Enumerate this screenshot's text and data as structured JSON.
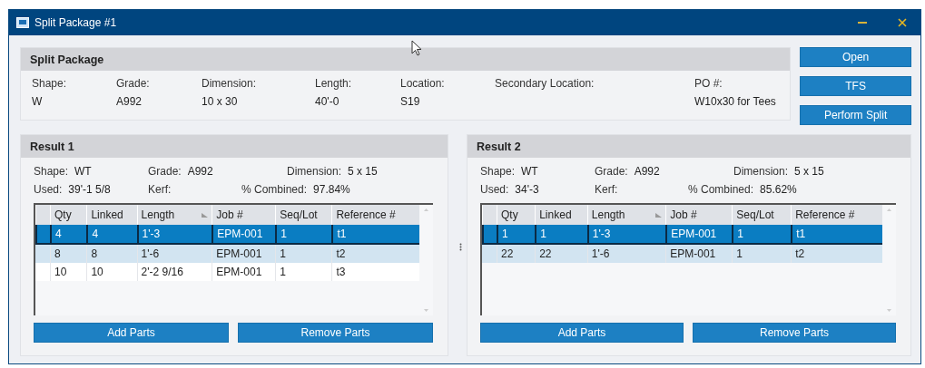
{
  "window": {
    "title": "Split Package #1"
  },
  "package": {
    "title": "Split Package",
    "fields": [
      {
        "label": "Shape:",
        "value": "W"
      },
      {
        "label": "Grade:",
        "value": "A992"
      },
      {
        "label": "Dimension:",
        "value": "10 x 30"
      },
      {
        "label": "Length:",
        "value": "40'-0"
      },
      {
        "label": "Location:",
        "value": "S19"
      },
      {
        "label": "Secondary Location:"
      },
      {
        "label": "PO #:",
        "value": "W10x30 for Tees"
      }
    ]
  },
  "buttons": [
    "Open",
    "TFS",
    "Perform Split"
  ],
  "results": [
    {
      "title": "Result 1",
      "info": [
        [
          {
            "label": "Shape:",
            "value": "WT"
          },
          {
            "label": "Grade:",
            "value": "A992"
          },
          {
            "label": "Dimension:",
            "value": "5 x 15"
          }
        ],
        [
          {
            "label": "Used:",
            "value": "39'-1 5/8"
          },
          {
            "label": "Kerf:"
          },
          {
            "label": "% Combined:",
            "value": "97.84%"
          }
        ]
      ],
      "columns": [
        {
          "label": "Qty",
          "sorted": false
        },
        {
          "label": "Linked",
          "sorted": false
        },
        {
          "label": "Length",
          "sorted": true
        },
        {
          "label": "Job #",
          "sorted": false
        },
        {
          "label": "Seq/Lot",
          "sorted": false
        },
        {
          "label": "Reference #",
          "sorted": false
        }
      ],
      "rows": [
        {
          "cells": [
            "4",
            "4",
            "1'-3",
            "EPM-001",
            "1",
            "t1"
          ],
          "selected": true
        },
        {
          "cells": [
            "8",
            "8",
            "1'-6",
            "EPM-001",
            "1",
            "t2"
          ],
          "selected": false
        },
        {
          "cells": [
            "10",
            "10",
            "2'-2 9/16",
            "EPM-001",
            "1",
            "t3"
          ],
          "selected": false
        }
      ],
      "buttons": [
        "Add Parts",
        "Remove Parts"
      ]
    },
    {
      "title": "Result 2",
      "info": [
        [
          {
            "label": "Shape:",
            "value": "WT"
          },
          {
            "label": "Grade:",
            "value": "A992"
          },
          {
            "label": "Dimension:",
            "value": "5 x 15"
          }
        ],
        [
          {
            "label": "Used:",
            "value": "34'-3"
          },
          {
            "label": "Kerf:"
          },
          {
            "label": "% Combined:",
            "value": "85.62%"
          }
        ]
      ],
      "columns": [
        {
          "label": "Qty",
          "sorted": false
        },
        {
          "label": "Linked",
          "sorted": false
        },
        {
          "label": "Length",
          "sorted": true
        },
        {
          "label": "Job #",
          "sorted": false
        },
        {
          "label": "Seq/Lot",
          "sorted": false
        },
        {
          "label": "Reference #",
          "sorted": false
        }
      ],
      "rows": [
        {
          "cells": [
            "1",
            "1",
            "1'-3",
            "EPM-001",
            "1",
            "t1"
          ],
          "selected": true
        },
        {
          "cells": [
            "22",
            "22",
            "1'-6",
            "EPM-001",
            "1",
            "t2"
          ],
          "selected": false
        }
      ],
      "buttons": [
        "Add Parts",
        "Remove Parts"
      ]
    }
  ]
}
